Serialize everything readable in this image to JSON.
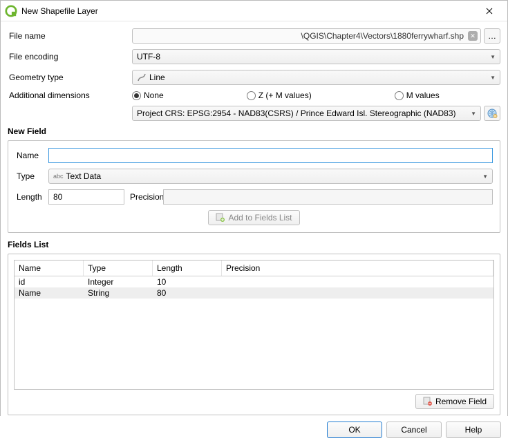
{
  "window": {
    "title": "New Shapefile Layer"
  },
  "labels": {
    "file_name": "File name",
    "file_encoding": "File encoding",
    "geometry_type": "Geometry type",
    "additional_dimensions": "Additional dimensions",
    "new_field": "New Field",
    "fields_list": "Fields List",
    "name": "Name",
    "type": "Type",
    "length": "Length",
    "precision": "Precision",
    "add_to_fields": "Add to Fields List",
    "remove_field": "Remove Field"
  },
  "file": {
    "path": "\\QGIS\\Chapter4\\Vectors\\1880ferrywharf.shp",
    "browse": "…"
  },
  "encoding": {
    "value": "UTF-8"
  },
  "geometry": {
    "value": "Line"
  },
  "dimensions": {
    "options": [
      {
        "label": "None",
        "selected": true
      },
      {
        "label": "Z (+ M values)",
        "selected": false
      },
      {
        "label": "M values",
        "selected": false
      }
    ]
  },
  "crs": {
    "value": "Project CRS: EPSG:2954 - NAD83(CSRS) / Prince Edward Isl. Stereographic (NAD83)"
  },
  "new_field": {
    "name_value": "",
    "type_value": "Text Data",
    "length_value": "80",
    "precision_value": ""
  },
  "fields_table": {
    "headers": [
      "Name",
      "Type",
      "Length",
      "Precision"
    ],
    "rows": [
      {
        "name": "id",
        "type": "Integer",
        "length": "10",
        "precision": ""
      },
      {
        "name": "Name",
        "type": "String",
        "length": "80",
        "precision": ""
      }
    ]
  },
  "buttons": {
    "ok": "OK",
    "cancel": "Cancel",
    "help": "Help"
  }
}
